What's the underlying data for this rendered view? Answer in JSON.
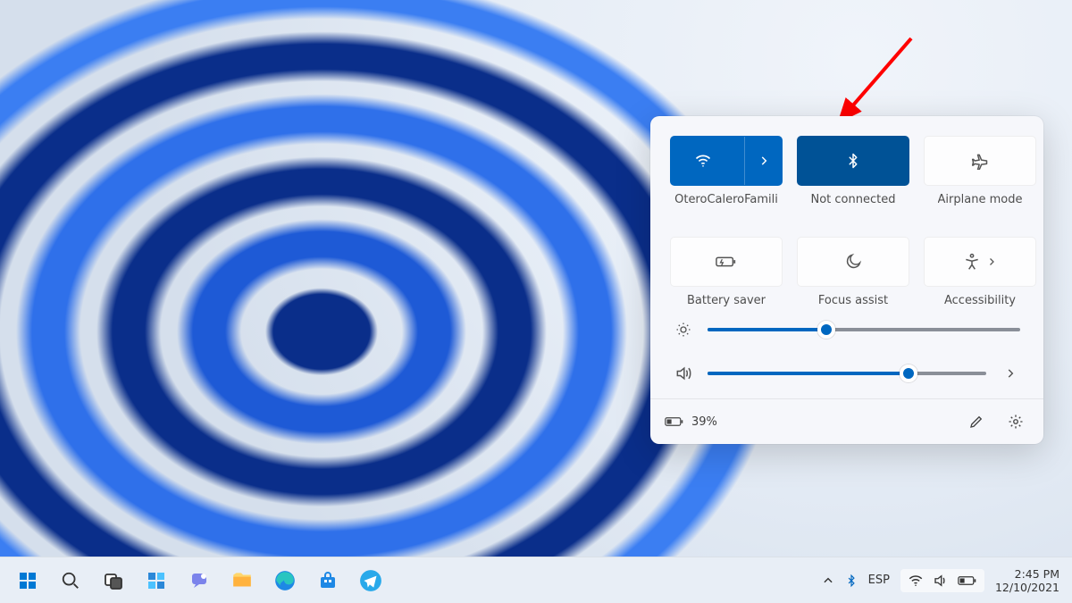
{
  "quick_settings": {
    "tiles": [
      {
        "id": "wifi",
        "label": "OteroCaleroFamili",
        "active": true,
        "split": true
      },
      {
        "id": "bluetooth",
        "label": "Not connected",
        "active": true
      },
      {
        "id": "airplane",
        "label": "Airplane mode",
        "active": false
      },
      {
        "id": "battery-saver",
        "label": "Battery saver",
        "active": false
      },
      {
        "id": "focus-assist",
        "label": "Focus assist",
        "active": false
      },
      {
        "id": "accessibility",
        "label": "Accessibility",
        "active": false,
        "split": true
      }
    ],
    "brightness_percent": 38,
    "volume_percent": 72,
    "battery_text": "39%"
  },
  "taskbar": {
    "language": "ESP",
    "time": "2:45 PM",
    "date": "12/10/2021"
  },
  "colors": {
    "accent": "#0067c0",
    "accent_dark": "#005296"
  }
}
